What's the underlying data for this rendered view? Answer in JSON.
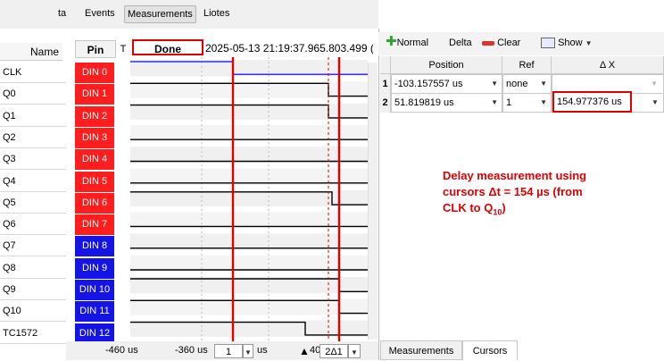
{
  "top_tabs": [
    {
      "label": "ta",
      "selected": false
    },
    {
      "label": "Events",
      "selected": false
    },
    {
      "label": "Measurements",
      "selected": true
    },
    {
      "label": "Liotes",
      "selected": false
    }
  ],
  "signals": {
    "name_header": "Name",
    "pin_header": "Pin",
    "t_header": "T",
    "status": "Done",
    "timestamp": "2025-05-13 21:19:37.965.803.499 (",
    "rows": [
      {
        "name": "CLK",
        "pin": "DIN  0",
        "color": "red"
      },
      {
        "name": "Q0",
        "pin": "DIN  1",
        "color": "red"
      },
      {
        "name": "Q1",
        "pin": "DIN  2",
        "color": "red"
      },
      {
        "name": "Q2",
        "pin": "DIN  3",
        "color": "red"
      },
      {
        "name": "Q3",
        "pin": "DIN  4",
        "color": "red"
      },
      {
        "name": "Q4",
        "pin": "DIN  5",
        "color": "red"
      },
      {
        "name": "Q5",
        "pin": "DIN  6",
        "color": "red"
      },
      {
        "name": "Q6",
        "pin": "DIN  7",
        "color": "red"
      },
      {
        "name": "Q7",
        "pin": "DIN  8",
        "color": "blue"
      },
      {
        "name": "Q8",
        "pin": "DIN  9",
        "color": "blue"
      },
      {
        "name": "Q9",
        "pin": "DIN 10",
        "color": "blue"
      },
      {
        "name": "Q10",
        "pin": "DIN 11",
        "color": "blue"
      },
      {
        "name": "TC1572",
        "pin": "DIN 12",
        "color": "blue"
      }
    ]
  },
  "timeline": {
    "scale_left": "-460 us",
    "scale_mid": "-360 us",
    "spin_value": "1",
    "spin_unit": "us",
    "scale_right": "40",
    "delta_label": "2Δ1"
  },
  "toolbar": {
    "normal": "Normal",
    "delta": "Delta",
    "clear": "Clear",
    "show": "Show"
  },
  "cursor_table": {
    "headers": {
      "position": "Position",
      "ref": "Ref",
      "dx": "Δ X"
    },
    "rows": [
      {
        "num": "1",
        "position": "-103.157557 us",
        "ref": "none",
        "dx": ""
      },
      {
        "num": "2",
        "position": "51.819819 us",
        "ref": "1",
        "dx": "154.977376 us"
      }
    ]
  },
  "annotation": {
    "line1": "Delay measurement using",
    "line2_pre": "cursors ",
    "line2_delta": "Δt = 154  µs (from",
    "line3": "CLK to Q",
    "line3_sub": "10",
    "line3_post": ")"
  },
  "bottom_tabs": [
    {
      "label": "Measurements",
      "selected": false
    },
    {
      "label": "Cursors",
      "selected": true
    }
  ],
  "colors": {
    "pin_red": "#ff1d1d",
    "pin_blue": "#1414e6",
    "cursor_red": "#e00000",
    "highlight": "#e00000",
    "clk_trace": "#3030ff"
  }
}
